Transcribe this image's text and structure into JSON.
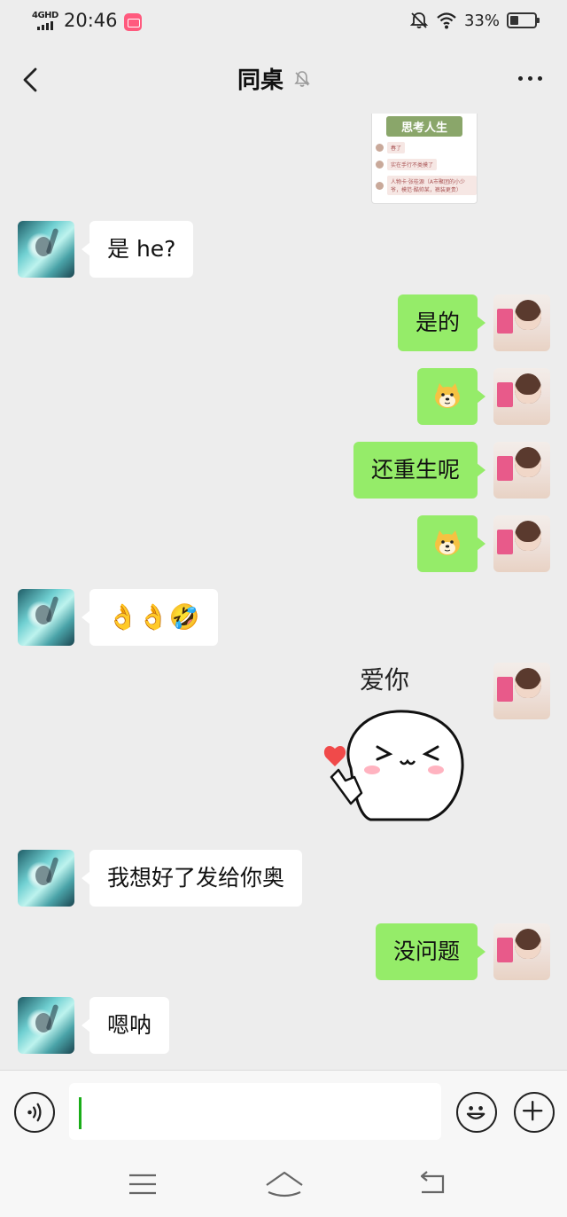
{
  "status_bar": {
    "network": "4GHD",
    "time": "20:46",
    "app_icon": "lofter-app-icon",
    "battery_percent": "33%",
    "battery_level": 0.33,
    "icons": [
      "mute-bell-icon",
      "wifi-icon",
      "battery-icon"
    ]
  },
  "header": {
    "title": "同桌",
    "back_icon": "chevron-left-icon",
    "mute_icon": "bell-off-icon",
    "more_icon": "more-dots-icon"
  },
  "image_message": {
    "header_text": "思考人生",
    "lines": [
      "春了",
      "实在手行不类摸了",
      "人物卡·张桂源（A市聚团的小少爷，模范·酷帅某，裤装更贵）"
    ]
  },
  "messages": [
    {
      "from": "them",
      "text": "是 he?"
    },
    {
      "from": "me",
      "text": "是的"
    },
    {
      "from": "me",
      "kind": "emoji",
      "emoji": "doge-emoji"
    },
    {
      "from": "me",
      "text": "还重生呢"
    },
    {
      "from": "me",
      "kind": "emoji",
      "emoji": "doge-emoji"
    },
    {
      "from": "them",
      "kind": "emoji",
      "text": "👌👌🤣"
    },
    {
      "from": "me",
      "kind": "sticker",
      "text": "爱你"
    },
    {
      "from": "them",
      "text": "我想好了发给你奥"
    },
    {
      "from": "me",
      "text": "没问题"
    },
    {
      "from": "them",
      "text": "嗯呐"
    }
  ],
  "input_bar": {
    "value": "",
    "voice_icon": "voice-icon",
    "emoji_icon": "emoji-icon",
    "plus_icon": "plus-icon"
  },
  "system_nav": {
    "icons": [
      "menu-icon",
      "home-icon",
      "back-icon"
    ]
  }
}
